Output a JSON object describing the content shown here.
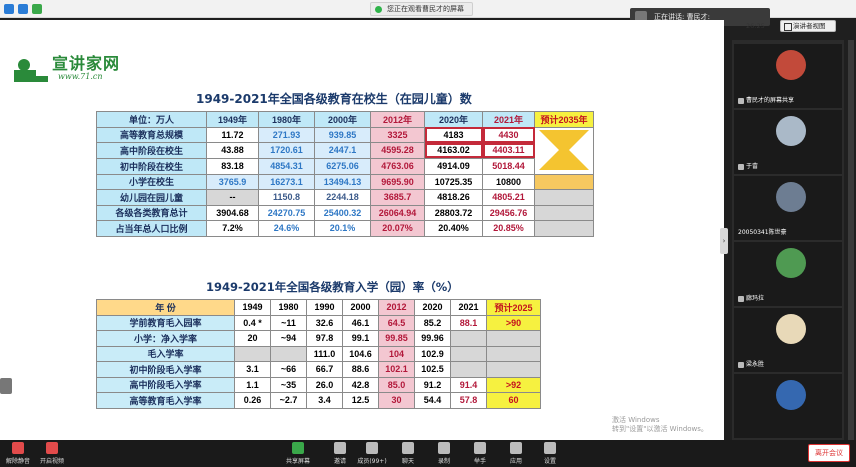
{
  "topbar": {
    "viewing_text": "您正在观看曹民才的屏幕"
  },
  "speaker": {
    "text": "正在讲话: 曹民才:"
  },
  "view_button": {
    "label": "演讲者视图"
  },
  "time": "26:25",
  "slide": {
    "logo": {
      "brand": "宣讲家网",
      "url": "www.71.cn"
    },
    "title1": "1949-2021年全国各级教育在校生（在园儿童）数",
    "table1": {
      "headers": [
        "单位：万人",
        "1949年",
        "1980年",
        "2000年",
        "2012年",
        "2020年",
        "2021年",
        "预计2035年"
      ],
      "rows": [
        {
          "label": "高等教育总规模",
          "values": [
            "11.72",
            "271.93",
            "939.85",
            "3325",
            "4183",
            "4430",
            ""
          ]
        },
        {
          "label": "高中阶段在校生",
          "values": [
            "43.88",
            "1720.61",
            "2447.1",
            "4595.28",
            "4163.02",
            "4403.11",
            ""
          ]
        },
        {
          "label": "初中阶段在校生",
          "values": [
            "83.18",
            "4854.31",
            "6275.06",
            "4763.06",
            "4914.09",
            "5018.44",
            ""
          ]
        },
        {
          "label": "小学在校生",
          "values": [
            "3765.9",
            "16273.1",
            "13494.13",
            "9695.90",
            "10725.35",
            "10800",
            ""
          ]
        },
        {
          "label": "幼儿园在园儿童",
          "values": [
            "--",
            "1150.8",
            "2244.18",
            "3685.7",
            "4818.26",
            "4805.21",
            ""
          ]
        },
        {
          "label": "各级各类教育总计",
          "values": [
            "3904.68",
            "24270.75",
            "25400.32",
            "26064.94",
            "28803.72",
            "29456.76",
            ""
          ]
        },
        {
          "label": "占当年总人口比例",
          "values": [
            "7.2%",
            "24.6%",
            "20.1%",
            "20.07%",
            "20.40%",
            "20.85%",
            ""
          ]
        }
      ]
    },
    "title2": "1949-2021年全国各级教育入学（园）率（%）",
    "table2": {
      "headers": [
        "年  份",
        "1949",
        "1980",
        "1990",
        "2000",
        "2012",
        "2020",
        "2021",
        "预计2025"
      ],
      "rows": [
        {
          "label": "学前教育毛入园率",
          "values": [
            "0.4 *",
            "~11",
            "32.6",
            "46.1",
            "64.5",
            "85.2",
            "88.1",
            ">90"
          ]
        },
        {
          "label": "小学：净入学率",
          "values": [
            "20",
            "~94",
            "97.8",
            "99.1",
            "99.85",
            "99.96",
            "",
            ""
          ]
        },
        {
          "label": "毛入学率",
          "values": [
            "",
            "",
            "111.0",
            "104.6",
            "104",
            "102.9",
            "",
            ""
          ]
        },
        {
          "label": "初中阶段毛入学率",
          "values": [
            "3.1",
            "~66",
            "66.7",
            "88.6",
            "102.1",
            "102.5",
            "",
            ""
          ]
        },
        {
          "label": "高中阶段毛入学率",
          "values": [
            "1.1",
            "~35",
            "26.0",
            "42.8",
            "85.0",
            "91.2",
            "91.4",
            ">92"
          ]
        },
        {
          "label": "高等教育毛入学率",
          "values": [
            "0.26",
            "~2.7",
            "3.4",
            "12.5",
            "30",
            "54.4",
            "57.8",
            "60"
          ]
        }
      ]
    },
    "watermark": {
      "line1": "激活 Windows",
      "line2": "转到\"设置\"以激活 Windows。"
    }
  },
  "participants": [
    {
      "name": "曹民才的屏幕共享",
      "color": "#c24a3a"
    },
    {
      "name": "于畲",
      "color": "#aab9c8"
    },
    {
      "name": "20050341陈世豪",
      "color": "#6d7d92"
    },
    {
      "name": "廊玛拉",
      "color": "#4f9a52"
    },
    {
      "name": "梁永胜",
      "color": "#e8d9b8"
    },
    {
      "name": "",
      "color": "#3568b0"
    }
  ],
  "toolbar": {
    "mute": "解除静音",
    "video": "开启视频",
    "share": "共享屏幕",
    "host": "邀请",
    "members": "成员(99+)",
    "chat": "聊天",
    "record": "录制",
    "reactions": "举手",
    "apps": "应用",
    "settings": "设置",
    "leave": "离开会议"
  }
}
